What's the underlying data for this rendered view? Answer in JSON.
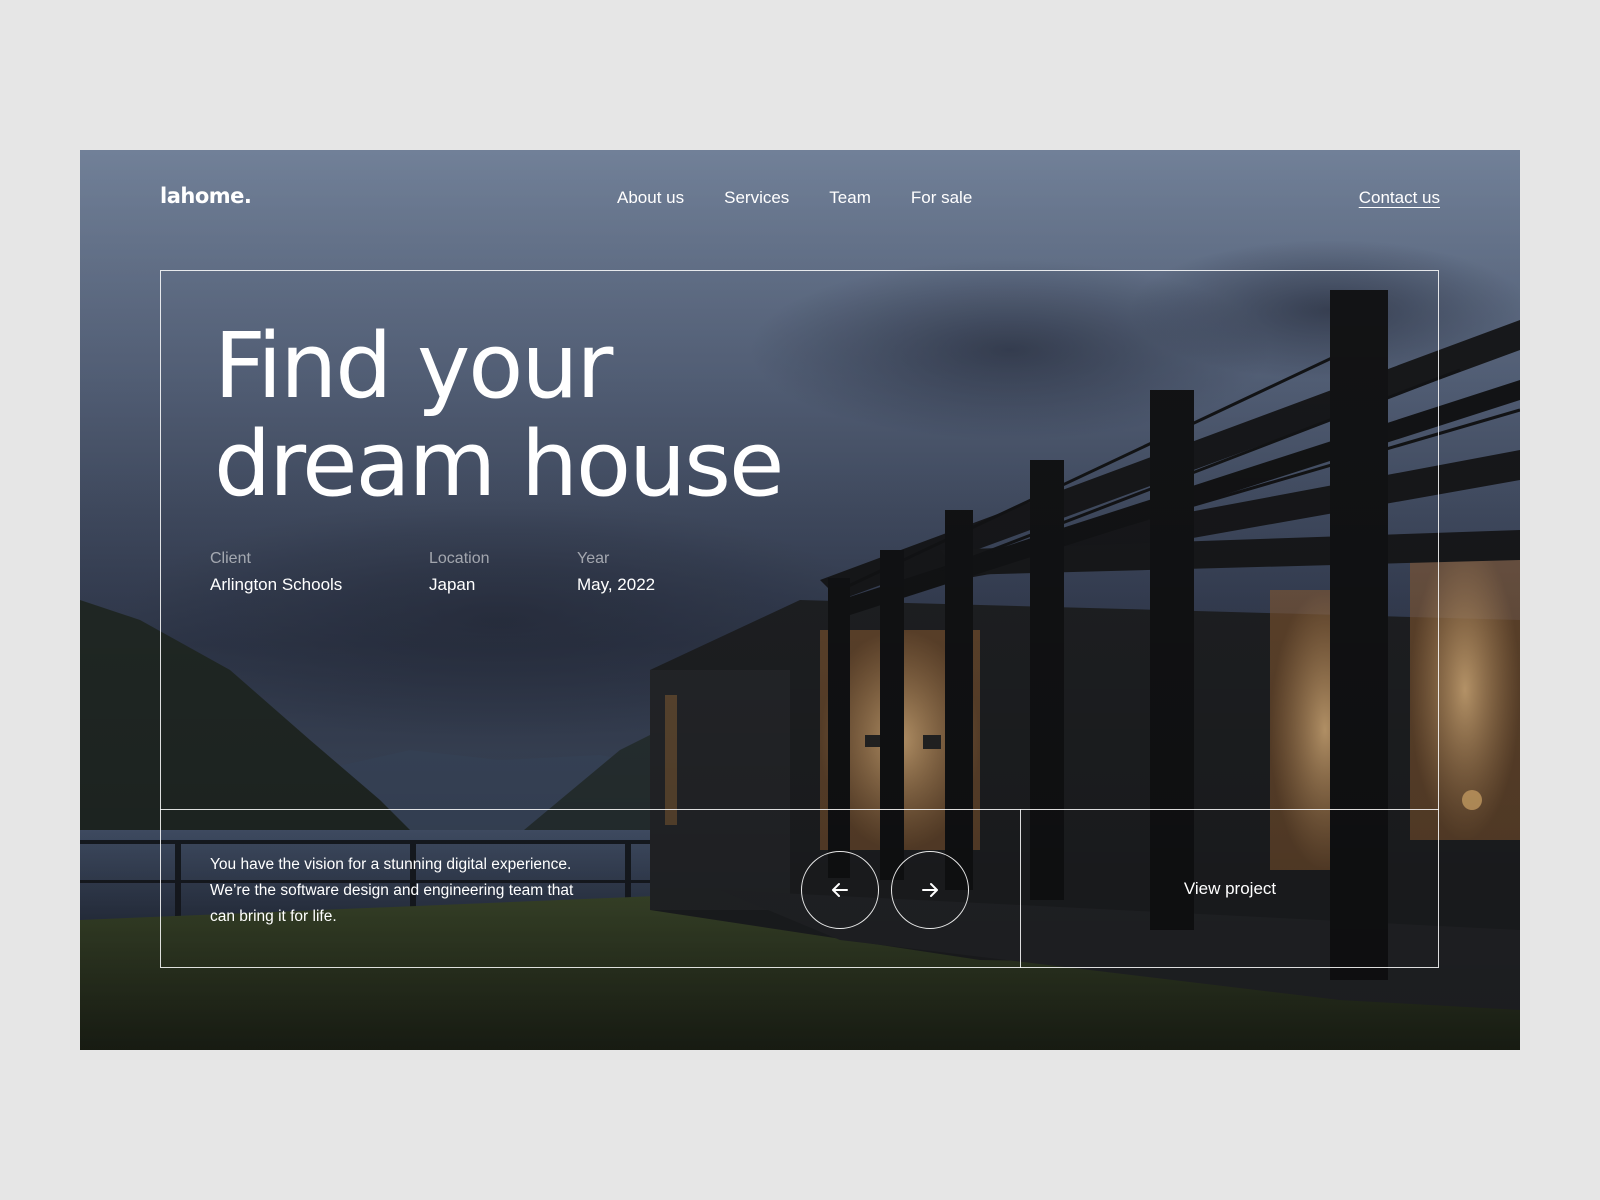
{
  "brand": {
    "logo": "lahome."
  },
  "nav": {
    "items": [
      {
        "label": "About us"
      },
      {
        "label": "Services"
      },
      {
        "label": "Team"
      },
      {
        "label": "For sale"
      }
    ],
    "contact": "Contact us"
  },
  "hero": {
    "headline_line1": "Find your",
    "headline_line2": "dream house",
    "meta": {
      "client_label": "Client",
      "client_value": "Arlington Schools",
      "location_label": "Location",
      "location_value": "Japan",
      "year_label": "Year",
      "year_value": "May, 2022"
    },
    "description": "You have the vision for a stunning digital experience. We’re the software design and engineering team that can bring it for life.",
    "prev_icon": "arrow-left-icon",
    "next_icon": "arrow-right-icon",
    "view_project": "View project"
  },
  "colors": {
    "page_background": "#e6e6e6",
    "text": "#ffffff",
    "sky": "#5d6b85",
    "dusk": "#2c3447",
    "grass": "#3c4a2c"
  }
}
